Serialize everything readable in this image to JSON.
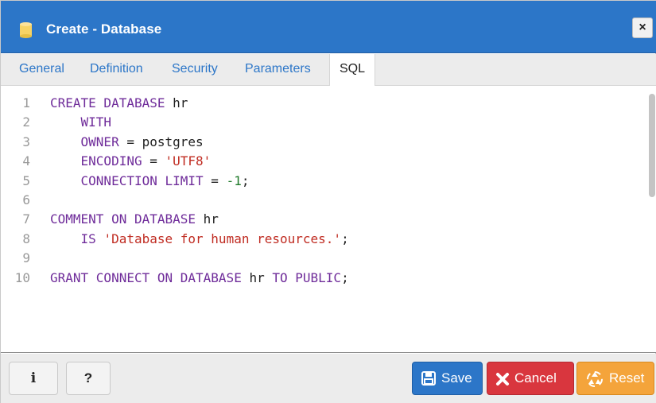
{
  "dialog": {
    "title": "Create - Database",
    "close_label": "×"
  },
  "tabs": [
    {
      "label": "General"
    },
    {
      "label": "Definition"
    },
    {
      "label": "Security"
    },
    {
      "label": "Parameters"
    },
    {
      "label": "SQL",
      "active": true
    }
  ],
  "editor": {
    "lines": [
      {
        "num": "1",
        "parts": [
          {
            "t": "CREATE DATABASE",
            "c": "kw"
          },
          {
            "t": " hr",
            "c": ""
          }
        ]
      },
      {
        "num": "2",
        "parts": [
          {
            "t": "    WITH",
            "c": "kw"
          }
        ]
      },
      {
        "num": "3",
        "parts": [
          {
            "t": "    OWNER",
            "c": "kw"
          },
          {
            "t": " = postgres",
            "c": ""
          }
        ]
      },
      {
        "num": "4",
        "parts": [
          {
            "t": "    ENCODING",
            "c": "kw"
          },
          {
            "t": " = ",
            "c": ""
          },
          {
            "t": "'UTF8'",
            "c": "str"
          }
        ]
      },
      {
        "num": "5",
        "parts": [
          {
            "t": "    CONNECTION LIMIT",
            "c": "kw"
          },
          {
            "t": " = ",
            "c": ""
          },
          {
            "t": "-1",
            "c": "num"
          },
          {
            "t": ";",
            "c": ""
          }
        ]
      },
      {
        "num": "6",
        "parts": []
      },
      {
        "num": "7",
        "parts": [
          {
            "t": "COMMENT ON DATABASE",
            "c": "kw"
          },
          {
            "t": " hr",
            "c": ""
          }
        ]
      },
      {
        "num": "8",
        "parts": [
          {
            "t": "    IS ",
            "c": "kw"
          },
          {
            "t": "'Database for human resources.'",
            "c": "str"
          },
          {
            "t": ";",
            "c": ""
          }
        ]
      },
      {
        "num": "9",
        "parts": []
      },
      {
        "num": "10",
        "parts": [
          {
            "t": "GRANT CONNECT ON DATABASE",
            "c": "kw"
          },
          {
            "t": " hr ",
            "c": ""
          },
          {
            "t": "TO PUBLIC",
            "c": "kw"
          },
          {
            "t": ";",
            "c": ""
          }
        ]
      }
    ]
  },
  "footer": {
    "info_label": "i",
    "help_label": "?",
    "save_label": "Save",
    "cancel_label": "Cancel",
    "reset_label": "Reset"
  },
  "colors": {
    "header": "#2c76c8",
    "keyword": "#6f2c9a",
    "string": "#c02c22",
    "number": "#1f7a2a",
    "save": "#2c76c8",
    "cancel": "#d9363e",
    "reset": "#f4a43b"
  },
  "icons": {
    "title": "database-icon",
    "close": "close-icon",
    "save": "floppy-disk-icon",
    "cancel": "x-icon",
    "reset": "recycle-icon"
  }
}
